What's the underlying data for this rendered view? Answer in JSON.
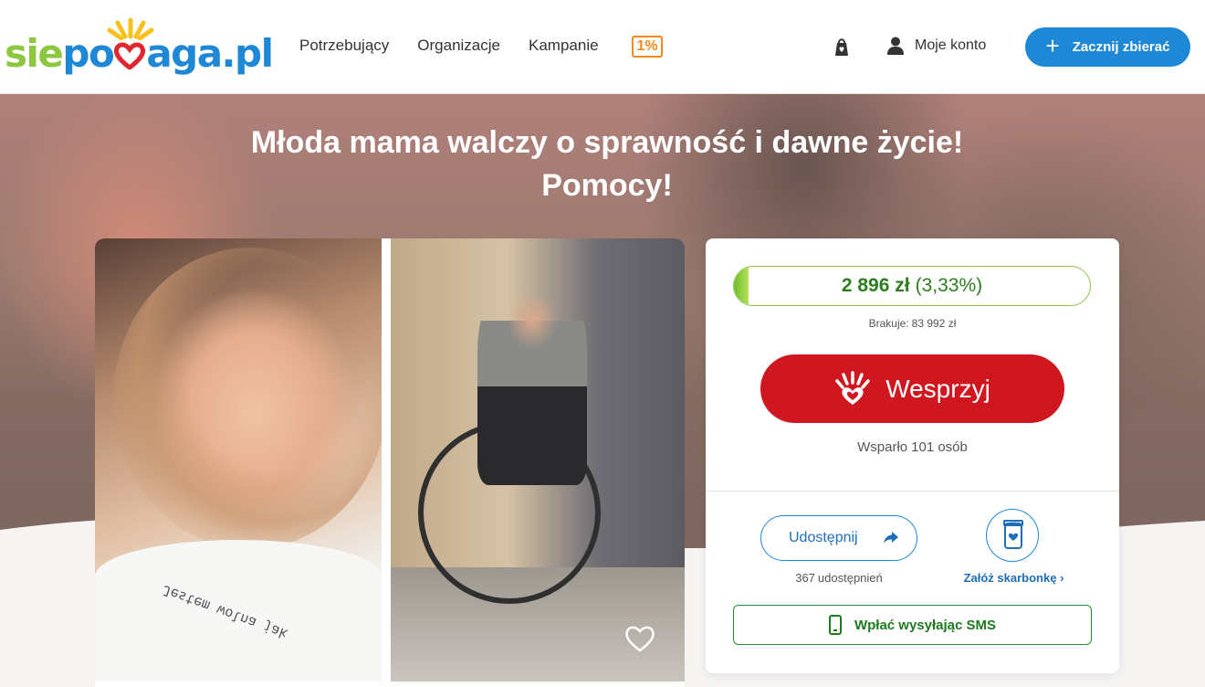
{
  "header": {
    "logo_part1": "sie",
    "logo_part2": "po",
    "logo_part3": "aga.pl",
    "nav": [
      "Potrzebujący",
      "Organizacje",
      "Kampanie"
    ],
    "one_percent": "1%",
    "account_label": "Moje konto",
    "start_label": "Zacznij zbierać"
  },
  "campaign": {
    "title_line1": "Młoda mama walczy o sprawność i dawne życie!",
    "title_line2": "Pomocy!",
    "photo_text": "Jestem wolna jak"
  },
  "card": {
    "amount": "2 896 zł",
    "percent": "(3,33%)",
    "progress_fraction": 0.0333,
    "missing_label": "Brakuje:",
    "missing_value": "83 992 zł",
    "donate_label": "Wesprzyj",
    "supporters_label": "Wsparło",
    "supporters_value": "101 osób",
    "share_label": "Udostępnij",
    "shares_count": "367",
    "shares_label": "udostępnień",
    "piggy_label": "Załóż skarbonkę",
    "sms_label": "Wpłać wysyłając SMS"
  },
  "colors": {
    "brand_blue": "#1e88d6",
    "brand_green": "#8dc63f",
    "donate_red": "#d0161f",
    "progress_green": "#6cbf2b",
    "one_percent_orange": "#ef8a1d"
  },
  "icons": [
    "sun-rays-icon",
    "heart-logo-icon",
    "bag-icon",
    "user-icon",
    "plus-icon",
    "heart-hand-icon",
    "share-arrow-icon",
    "piggy-jar-icon",
    "chevron-right-icon",
    "phone-icon",
    "heart-outline-icon"
  ]
}
